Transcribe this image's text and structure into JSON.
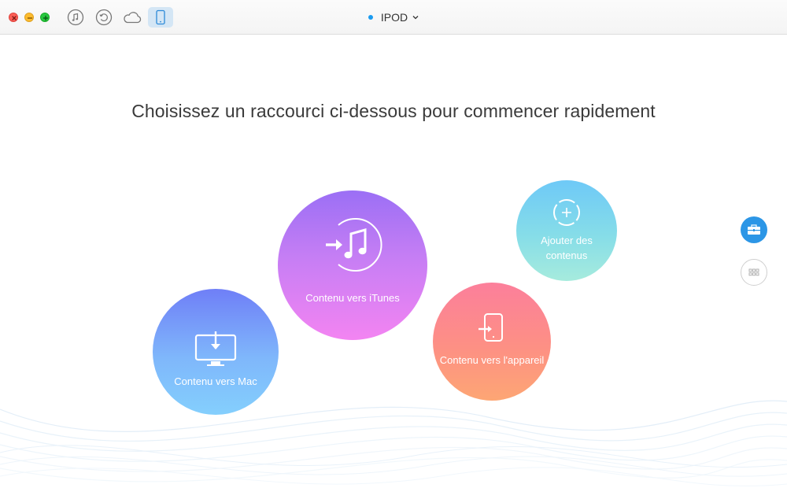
{
  "toolbar": {
    "buttons": [
      {
        "name": "itunes-library",
        "icon": "music-note-icon"
      },
      {
        "name": "backup-history",
        "icon": "history-icon"
      },
      {
        "name": "icloud",
        "icon": "cloud-icon"
      },
      {
        "name": "device",
        "icon": "phone-icon",
        "active": true
      }
    ],
    "device_name": "IPOD",
    "device_status_color": "#1a9bf0"
  },
  "main": {
    "headline": "Choisissez un raccourci ci-dessous pour commencer rapidement",
    "shortcuts": {
      "mac": {
        "label": "Contenu vers Mac",
        "icon": "monitor-download-icon"
      },
      "itunes": {
        "label": "Contenu vers iTunes",
        "icon": "itunes-transfer-icon"
      },
      "device": {
        "label": "Contenu vers l'appareil",
        "icon": "phone-transfer-icon"
      },
      "add": {
        "label_line1": "Ajouter des",
        "label_line2": "contenus",
        "icon": "add-circle-icon"
      }
    }
  },
  "side": {
    "toolkit_icon": "toolbox-icon",
    "grid_icon": "grid-icon",
    "accent": "#2c96e6"
  }
}
